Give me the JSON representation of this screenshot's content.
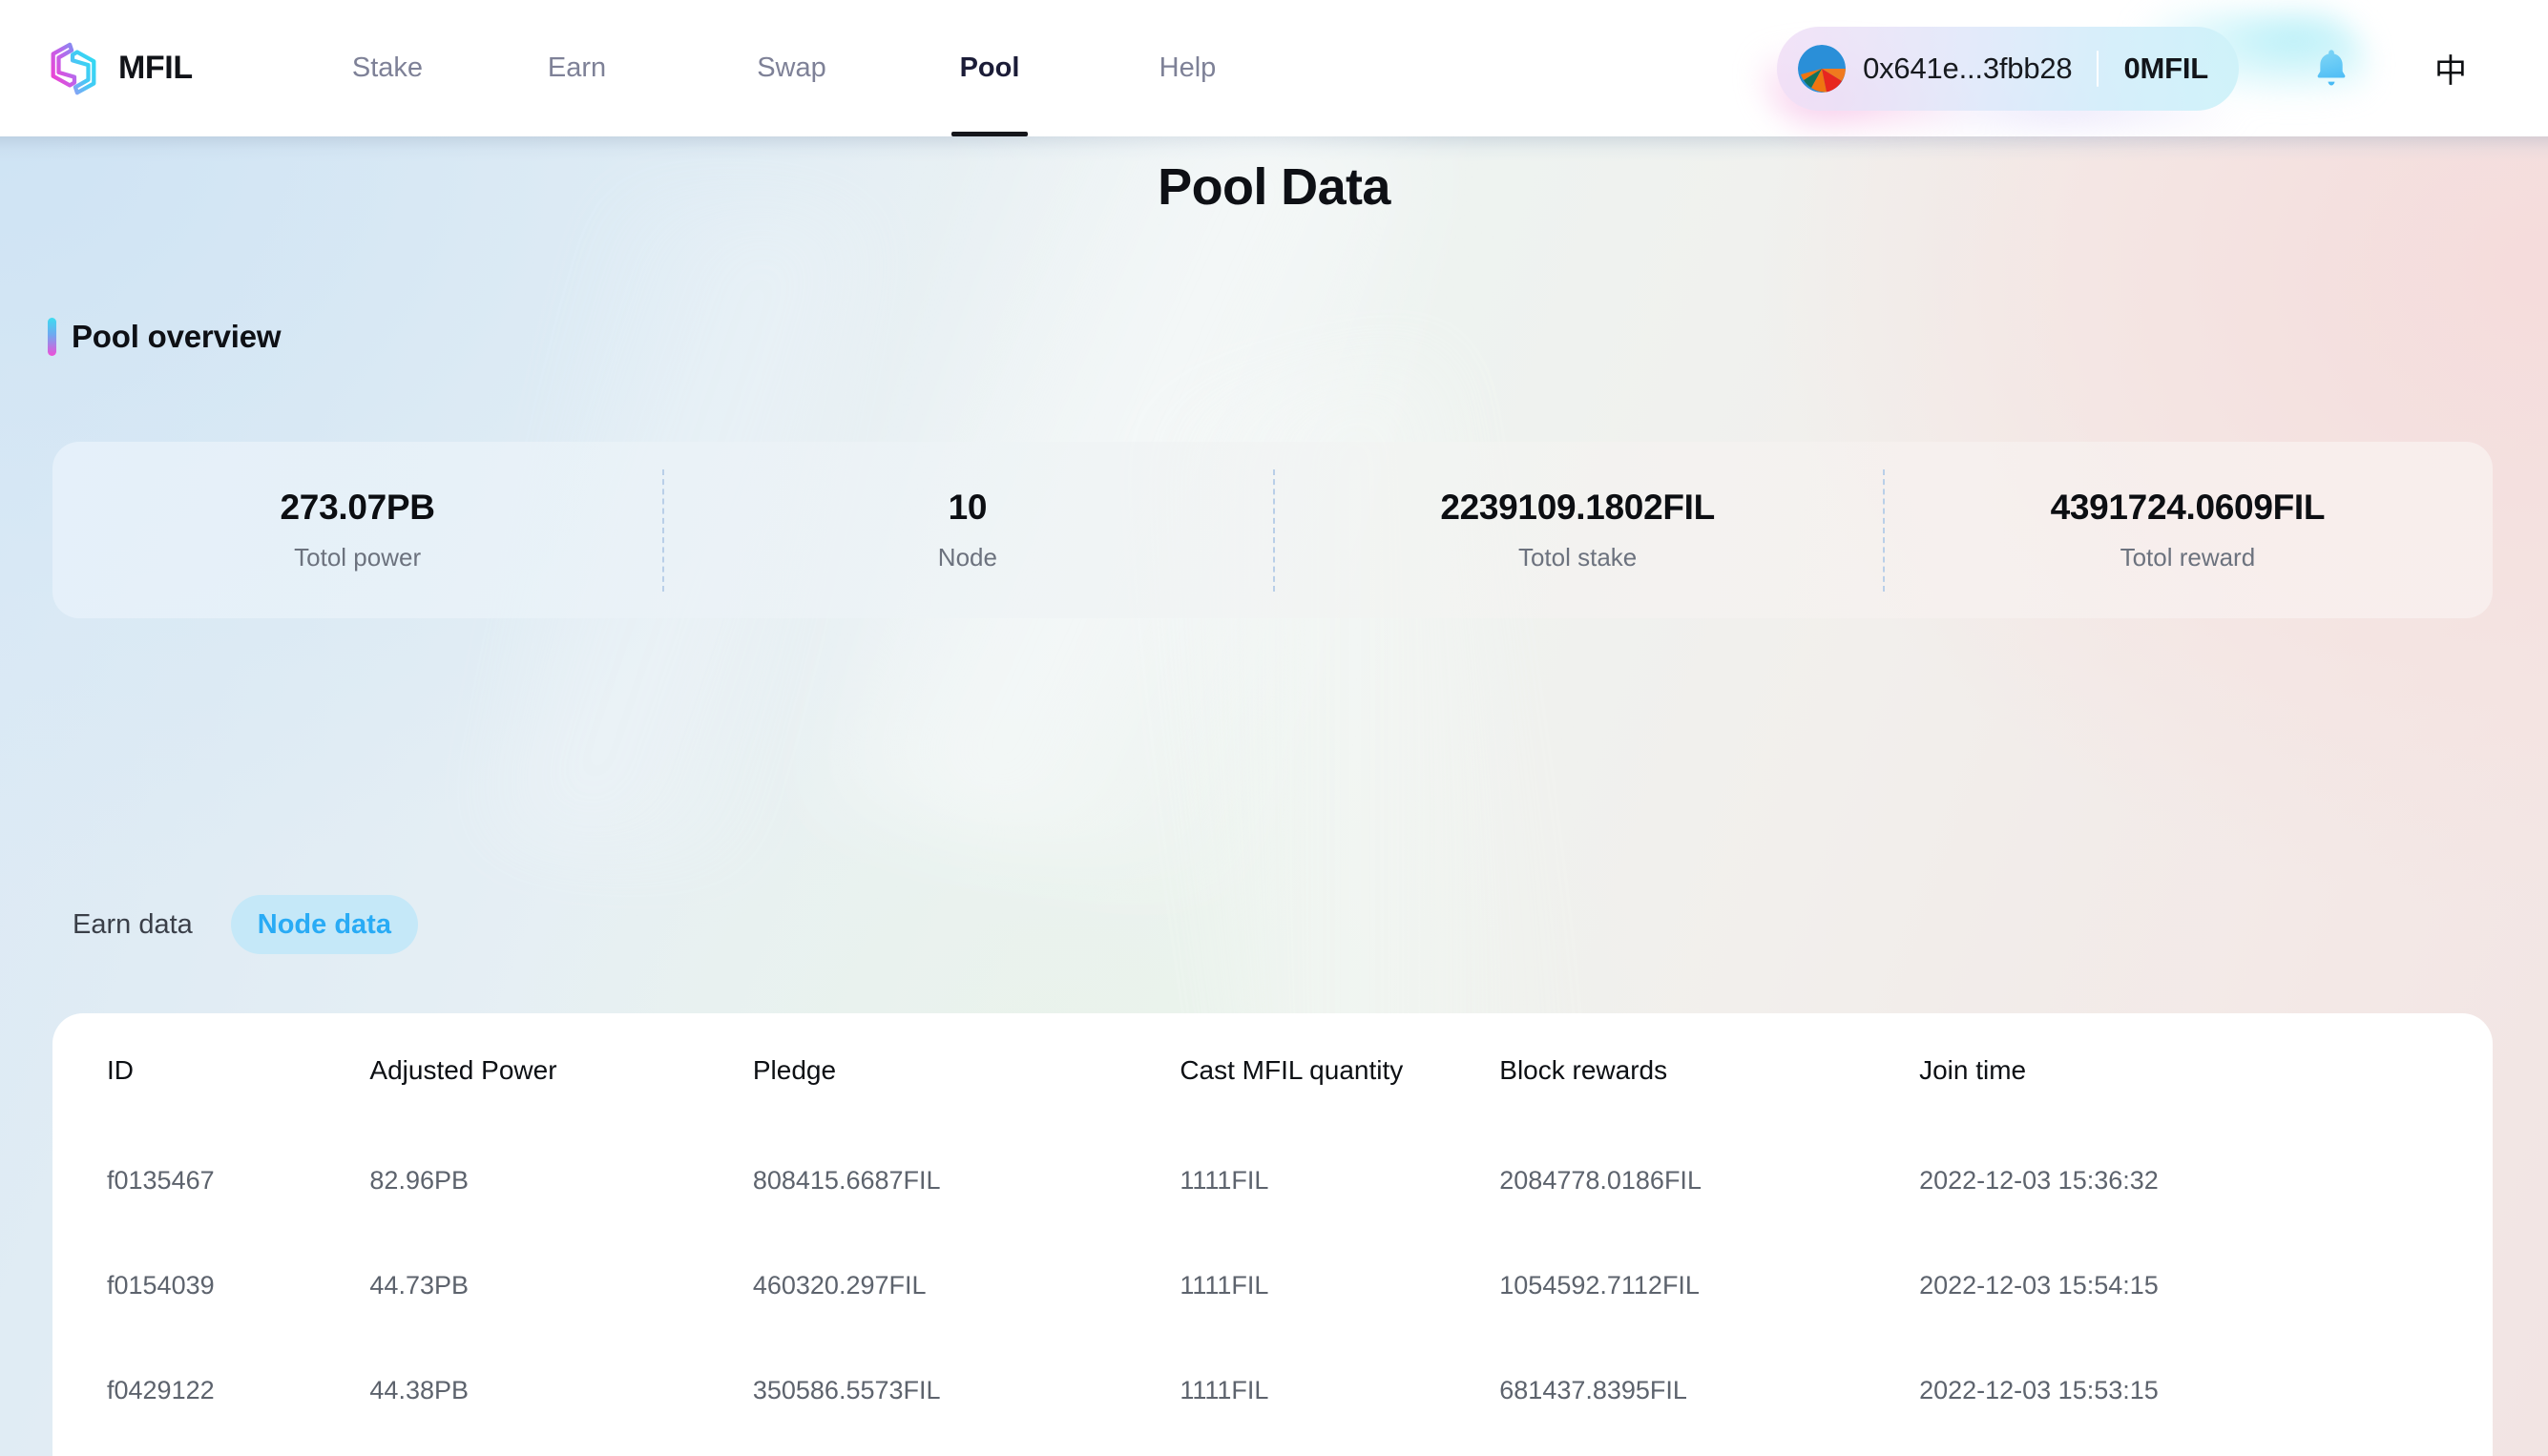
{
  "brand": {
    "name": "MFIL",
    "logo_icon": "mfil-hexagon-logo"
  },
  "nav": {
    "items": [
      {
        "label": "Stake",
        "active": false
      },
      {
        "label": "Earn",
        "active": false
      },
      {
        "label": "Swap",
        "active": false
      },
      {
        "label": "Pool",
        "active": true
      },
      {
        "label": "Help",
        "active": false
      }
    ]
  },
  "header_right": {
    "wallet": {
      "avatar_icon": "wallet-avatar-pie",
      "address": "0x641e...3fbb28",
      "balance": "0MFIL"
    },
    "bell_icon": "notification-bell-icon",
    "language_label": "中"
  },
  "page": {
    "title": "Pool Data",
    "section_title": "Pool overview"
  },
  "overview": {
    "stats": [
      {
        "value": "273.07PB",
        "label": "Totol power"
      },
      {
        "value": "10",
        "label": "Node"
      },
      {
        "value": "2239109.1802FIL",
        "label": "Totol stake"
      },
      {
        "value": "4391724.0609FIL",
        "label": "Totol reward"
      }
    ]
  },
  "tabs": [
    {
      "label": "Earn data",
      "active": false
    },
    {
      "label": "Node data",
      "active": true
    }
  ],
  "table": {
    "columns": [
      "ID",
      "Adjusted Power",
      "Pledge",
      "Cast MFIL quantity",
      "Block rewards",
      "Join time"
    ],
    "rows": [
      {
        "id": "f0135467",
        "adjusted_power": "82.96PB",
        "pledge": "808415.6687FIL",
        "cast_mfil_quantity": "1111FIL",
        "block_rewards": "2084778.0186FIL",
        "join_time": "2022-12-03 15:36:32"
      },
      {
        "id": "f0154039",
        "adjusted_power": "44.73PB",
        "pledge": "460320.297FIL",
        "cast_mfil_quantity": "1111FIL",
        "block_rewards": "1054592.7112FIL",
        "join_time": "2022-12-03 15:54:15"
      },
      {
        "id": "f0429122",
        "adjusted_power": "44.38PB",
        "pledge": "350586.5573FIL",
        "cast_mfil_quantity": "1111FIL",
        "block_rewards": "681437.8395FIL",
        "join_time": "2022-12-03 15:53:15"
      }
    ]
  },
  "colors": {
    "accent_blue": "#29abf5",
    "tab_active_bg": "#c5e8f8",
    "logo_pink": "#ee4fd8",
    "logo_cyan": "#36d8f0",
    "nav_inactive": "#7e8197",
    "nav_active": "#1b1c37"
  }
}
